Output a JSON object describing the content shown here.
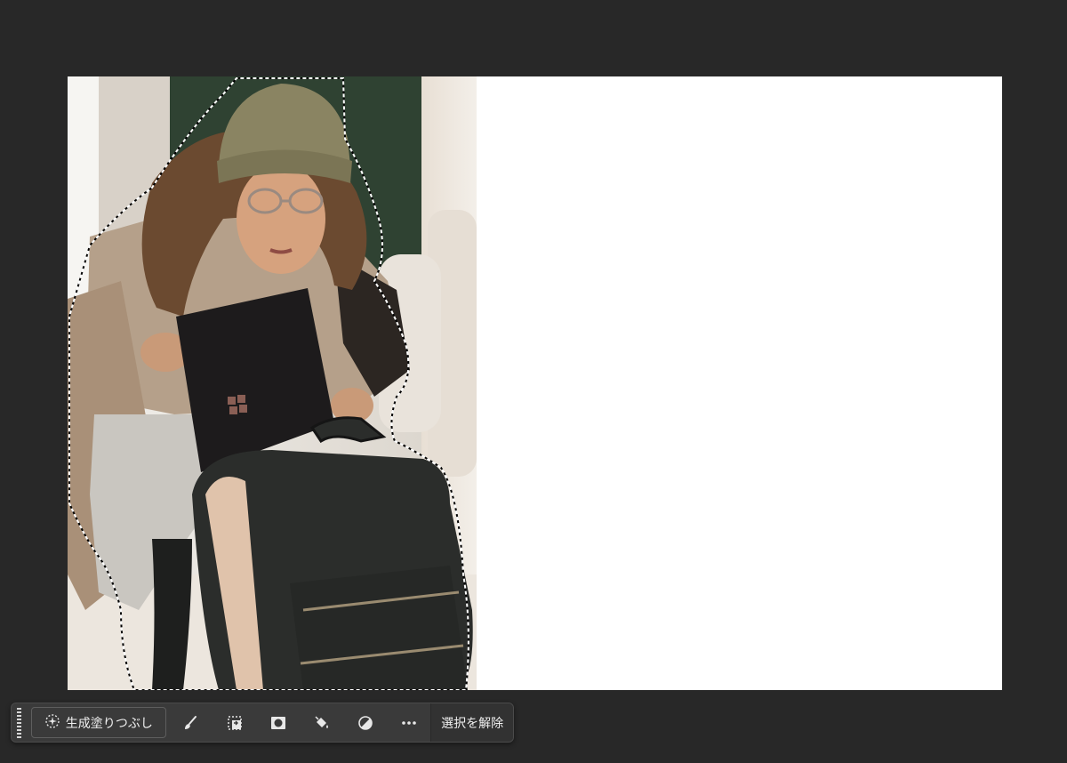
{
  "colors": {
    "workspace_bg": "#282828",
    "canvas_bg": "#ffffff",
    "taskbar_bg": "#3a3a3a",
    "text": "#f0f0f0"
  },
  "canvas": {
    "image": "woman-with-laptop-and-backpack-photo",
    "selection": "marching-ants-subject-selection"
  },
  "taskbar": {
    "generative_fill_label": "生成塗りつぶし",
    "tools": [
      {
        "icon": "brush-modify-selection-icon"
      },
      {
        "icon": "transform-selection-icon"
      },
      {
        "icon": "create-mask-icon"
      },
      {
        "icon": "fill-selection-icon"
      },
      {
        "icon": "adjustment-layer-icon"
      },
      {
        "icon": "more-options-icon"
      }
    ],
    "deselect_label": "選択を解除"
  }
}
